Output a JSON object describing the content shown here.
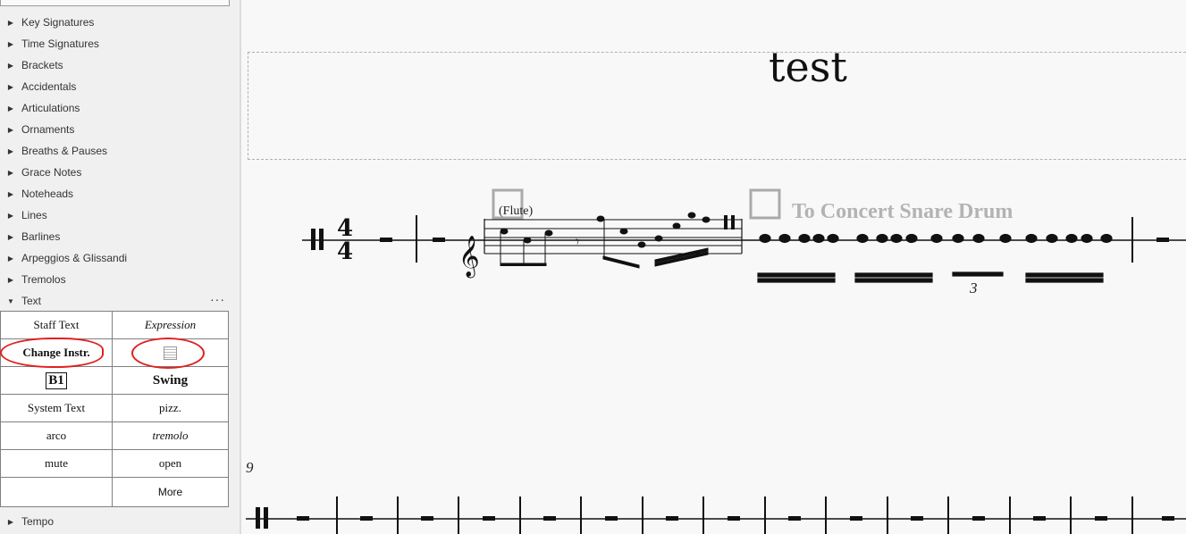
{
  "palette": {
    "categories": [
      {
        "label": "Key Signatures",
        "expanded": false
      },
      {
        "label": "Time Signatures",
        "expanded": false
      },
      {
        "label": "Brackets",
        "expanded": false
      },
      {
        "label": "Accidentals",
        "expanded": false
      },
      {
        "label": "Articulations",
        "expanded": false
      },
      {
        "label": "Ornaments",
        "expanded": false
      },
      {
        "label": "Breaths & Pauses",
        "expanded": false
      },
      {
        "label": "Grace Notes",
        "expanded": false
      },
      {
        "label": "Noteheads",
        "expanded": false
      },
      {
        "label": "Lines",
        "expanded": false
      },
      {
        "label": "Barlines",
        "expanded": false
      },
      {
        "label": "Arpeggios & Glissandi",
        "expanded": false
      },
      {
        "label": "Tremolos",
        "expanded": false
      },
      {
        "label": "Text",
        "expanded": true,
        "more_menu": "···"
      }
    ],
    "text_cells": [
      [
        "Staff Text",
        "Expression"
      ],
      [
        "Change Instr.",
        "frame-icon"
      ],
      [
        "B1",
        "Swing"
      ],
      [
        "System Text",
        "pizz."
      ],
      [
        "arco",
        "tremolo"
      ],
      [
        "mute",
        "open"
      ],
      [
        "",
        "More"
      ]
    ],
    "after_category": {
      "label": "Tempo",
      "expanded": false
    },
    "annotation_color": "#e02020"
  },
  "score": {
    "title": "test",
    "instrument_label": "(Flute)",
    "instrument_change": "To Concert Snare Drum",
    "time_signature": {
      "numerator": "4",
      "denominator": "4"
    },
    "tuplet_number": "3",
    "measure_number": "9"
  }
}
